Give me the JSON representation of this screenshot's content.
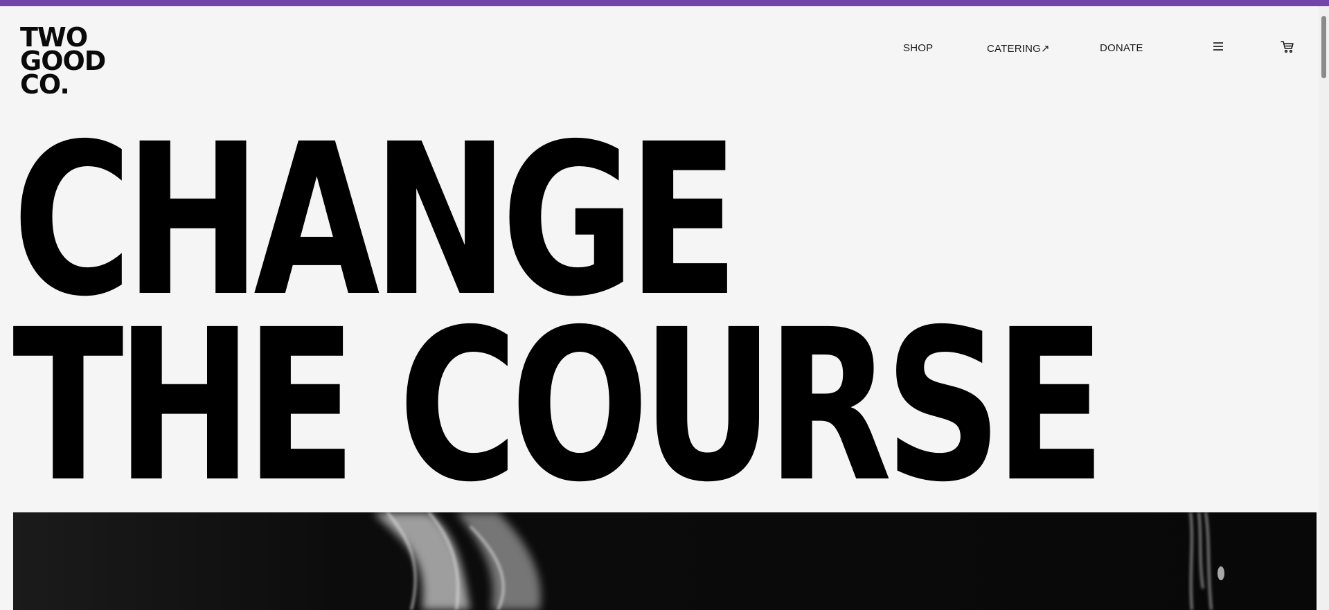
{
  "logo": {
    "line1": "TWO",
    "line2": "GOOD",
    "line3": "CO."
  },
  "nav": {
    "shop": "SHOP",
    "catering": "CATERING↗",
    "donate": "DONATE"
  },
  "icons": {
    "menu": "menu-icon",
    "cart": "cart-icon"
  },
  "hero": {
    "line1": "CHANGE",
    "line2": "THE COURSE"
  },
  "colors": {
    "accent_bar": "#7145aa",
    "background": "#f5f5f5",
    "text": "#000000"
  }
}
